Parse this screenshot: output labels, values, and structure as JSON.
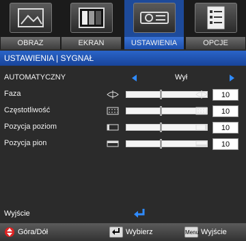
{
  "tabs": [
    {
      "label": "OBRAZ",
      "icon": "image-icon"
    },
    {
      "label": "EKRAN",
      "icon": "screen-icon"
    },
    {
      "label": "USTAWIENIA",
      "icon": "projector-icon"
    },
    {
      "label": "OPCJE",
      "icon": "checklist-icon"
    }
  ],
  "header": {
    "title": "USTAWIENIA | SYGNAŁ"
  },
  "auto": {
    "label": "AUTOMATYCZNY",
    "value": "Wył"
  },
  "sliders": [
    {
      "label": "Faza",
      "value": "10",
      "level": 0.43
    },
    {
      "label": "Częstotliwość",
      "value": "10",
      "level": 0.43
    },
    {
      "label": "Pozycja poziom",
      "value": "10",
      "level": 0.43
    },
    {
      "label": "Pozycja pion",
      "value": "10",
      "level": 0.43
    }
  ],
  "exit": {
    "label": "Wyjście"
  },
  "footer": {
    "nav": "Góra/Dół",
    "select": "Wybierz",
    "menu_key": "Menu",
    "exit": "Wyjście"
  },
  "colors": {
    "accent": "#2f8bff",
    "header": "#1f55b5",
    "active_tab": "#1d4a9a"
  }
}
